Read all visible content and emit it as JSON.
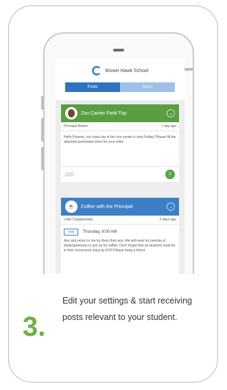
{
  "phone": {
    "school_name": "Brown Hawk School",
    "tabs": [
      {
        "label": "Posts",
        "active": true
      },
      {
        "label": "Alerts",
        "active": false
      }
    ],
    "posts": [
      {
        "title": "Zoo Carrier Field Trip",
        "author": "Principal Brown",
        "time": "1 day ago",
        "body": "Hello Parents, our class trip to the zoo center is next Friday! Please fill the attached permission form for your child.",
        "likes": "0/0",
        "comment_count": "0",
        "color": "#5a9e44"
      },
      {
        "title": "Coffee with the Principal",
        "author": "Leah Cartgentoods",
        "time": "3 days ago",
        "rsvp_label": "rsvp",
        "date": "Thursday, 8:00 AM",
        "body": "Any and return to me try them then any. We will meet for parents of kindergarteners to join us for coffee. Don't forget that all students must be in their homeroom class by 8:00 Please bring a friend.",
        "color": "#3d7fc6"
      }
    ]
  },
  "step": {
    "number": "3.",
    "text": "Edit your settings & start receiving posts relevant to your student."
  },
  "colors": {
    "accent_green": "#6fb043",
    "tab_blue": "#2f73bf"
  }
}
